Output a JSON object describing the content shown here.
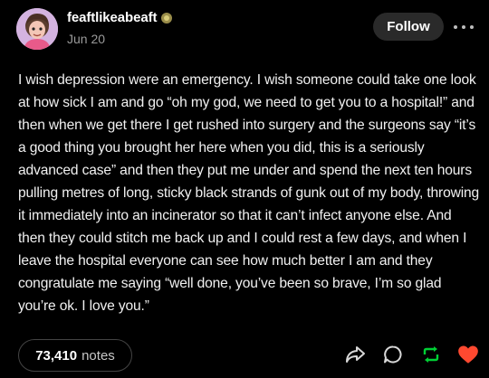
{
  "post": {
    "username": "feaftlikeabeaft",
    "date": "Jun 20",
    "follow_label": "Follow",
    "body": "I wish depression were an emergency. I wish someone could take one look at how sick I am and go “oh my god, we need to get you to a hospital!” and then when we get there I get rushed into surgery and the surgeons say “it’s a good thing you brought her here when you did, this is a seriously advanced case” and then they put me under and spend the next ten hours pulling metres of long, sticky black strands of gunk out of my body, throwing it immediately into an incinerator so that it can’t infect anyone else. And then they could stitch me back up and I could rest a few days, and when I leave the hospital everyone can see how much better I am and they congratulate me saying “well done, you’ve been so brave, I’m so glad you’re ok. I love you.”"
  },
  "footer": {
    "notes_count": "73,410",
    "notes_label": "notes"
  },
  "icons": {
    "badge": "verified-badge-icon",
    "more": "more-options-icon",
    "share": "share-icon",
    "reply": "reply-icon",
    "reblog": "reblog-icon",
    "like": "heart-icon"
  },
  "colors": {
    "background": "#000000",
    "reblog": "#00cf35",
    "like": "#ff4930"
  }
}
